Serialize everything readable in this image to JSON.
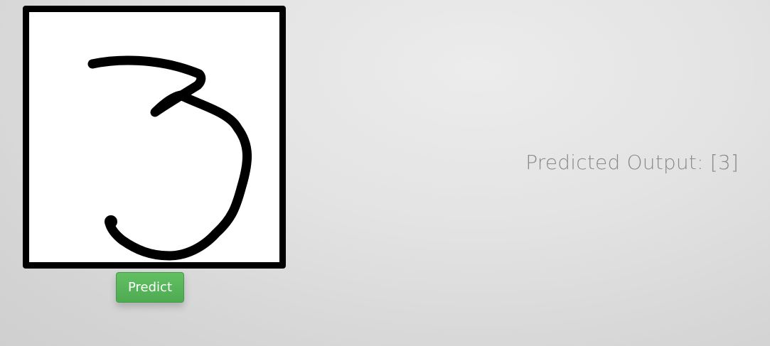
{
  "drawing_canvas": {
    "drawn_digit": "3",
    "stroke_color": "#000000",
    "background_color": "#ffffff"
  },
  "predict_button": {
    "label": "Predict",
    "color": "#5cb85c"
  },
  "output": {
    "label": "Predicted Output: [3]",
    "color": "#8a8a8a"
  }
}
